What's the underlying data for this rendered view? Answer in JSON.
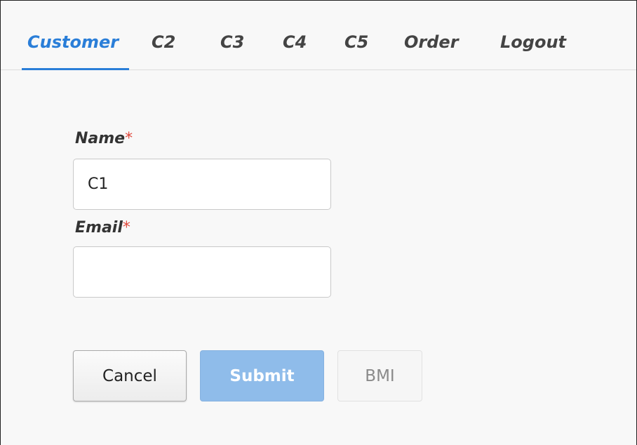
{
  "tabs": [
    {
      "label": "Customer",
      "active": true
    },
    {
      "label": "C2"
    },
    {
      "label": "C3"
    },
    {
      "label": "C4"
    },
    {
      "label": "C5"
    },
    {
      "label": "Order"
    },
    {
      "label": "Logout"
    }
  ],
  "form": {
    "name_label": "Name",
    "name_required": "*",
    "name_value": "C1",
    "email_label": "Email",
    "email_required": "*",
    "email_value": ""
  },
  "buttons": {
    "cancel": "Cancel",
    "submit": "Submit",
    "bmi": "BMI"
  },
  "colors": {
    "active_tab": "#2a7ed8",
    "required_marker": "#e0483c",
    "submit_bg": "#8fbcea"
  }
}
